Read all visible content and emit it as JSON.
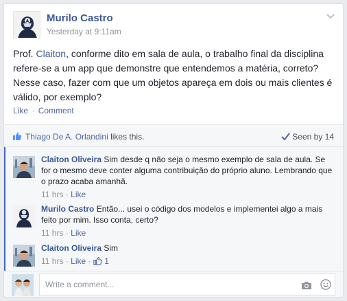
{
  "post": {
    "author": "Murilo Castro",
    "timestamp": "Yesterday at 9:11am",
    "text_before": "Prof. ",
    "mention": "Claiton",
    "text_after": ", conforme dito em sala de aula, o trabalho final da disciplina refere-se a um app que demonstre que entendemos a matéria, correto? Nesse caso, fazer com que um objetos apareça em dois ou mais clientes é válido, por exemplo?",
    "like_label": "Like",
    "comment_label": "Comment",
    "separator": "·"
  },
  "likes": {
    "liker": "Thiago De A. Orlandini",
    "suffix": " likes this.",
    "seen": "Seen by 14"
  },
  "comments": [
    {
      "author": "Claiton Oliveira",
      "text": "Sim desde q não seja o mesmo exemplo de sala de aula. Se for o mesmo deve conter alguma contribuição do próprio aluno. Lembrando que o prazo acaba amanhã.",
      "time": "11 hrs",
      "like_label": "Like"
    },
    {
      "author": "Murilo Castro",
      "text": "Então... usei o código dos modelos e implementei algo a mais feito por mim. Isso conta, certo?",
      "time": "11 hrs",
      "like_label": "Like"
    },
    {
      "author": "Claiton Oliveira",
      "text": "Sim",
      "time": "11 hrs",
      "like_label": "Like",
      "like_count": "1"
    }
  ],
  "composer": {
    "placeholder": "Write a comment..."
  },
  "colors": {
    "link": "#3b5998",
    "accent_bar": "#4267b2",
    "muted": "#90949c"
  },
  "icons": [
    "chevron-down-icon",
    "thumbs-up-icon",
    "check-icon",
    "camera-icon",
    "smiley-icon"
  ]
}
